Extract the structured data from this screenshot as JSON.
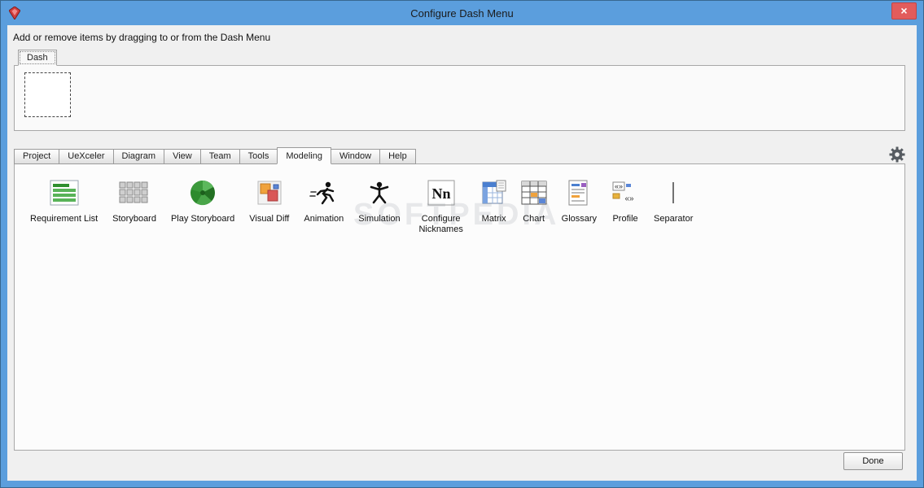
{
  "window": {
    "title": "Configure Dash Menu",
    "close_glyph": "×"
  },
  "instruction": "Add or remove items by dragging to or from the Dash Menu",
  "dash_section": {
    "tab_label": "Dash"
  },
  "menu_tabs": {
    "active": "Modeling",
    "tabs": [
      {
        "label": "Project"
      },
      {
        "label": "UeXceler"
      },
      {
        "label": "Diagram"
      },
      {
        "label": "View"
      },
      {
        "label": "Team"
      },
      {
        "label": "Tools"
      },
      {
        "label": "Modeling"
      },
      {
        "label": "Window"
      },
      {
        "label": "Help"
      }
    ]
  },
  "items": [
    {
      "label": "Requirement List",
      "icon": "requirement-list-icon"
    },
    {
      "label": "Storyboard",
      "icon": "storyboard-icon"
    },
    {
      "label": "Play Storyboard",
      "icon": "play-storyboard-icon"
    },
    {
      "label": "Visual Diff",
      "icon": "visual-diff-icon"
    },
    {
      "label": "Animation",
      "icon": "animation-icon"
    },
    {
      "label": "Simulation",
      "icon": "simulation-icon"
    },
    {
      "label": "Configure Nicknames",
      "icon": "configure-nicknames-icon",
      "two_line": true
    },
    {
      "label": "Matrix",
      "icon": "matrix-icon"
    },
    {
      "label": "Chart",
      "icon": "chart-icon"
    },
    {
      "label": "Glossary",
      "icon": "glossary-icon"
    },
    {
      "label": "Profile",
      "icon": "profile-icon"
    },
    {
      "label": "Separator",
      "icon": "separator-icon"
    }
  ],
  "footer": {
    "done_label": "Done"
  },
  "watermark": "SOFTPEDIA",
  "colors": {
    "frame_blue": "#5b9edd",
    "close_red": "#e25c5c",
    "panel_bg": "#fcfcfc",
    "body_bg": "#f0f0f0"
  }
}
